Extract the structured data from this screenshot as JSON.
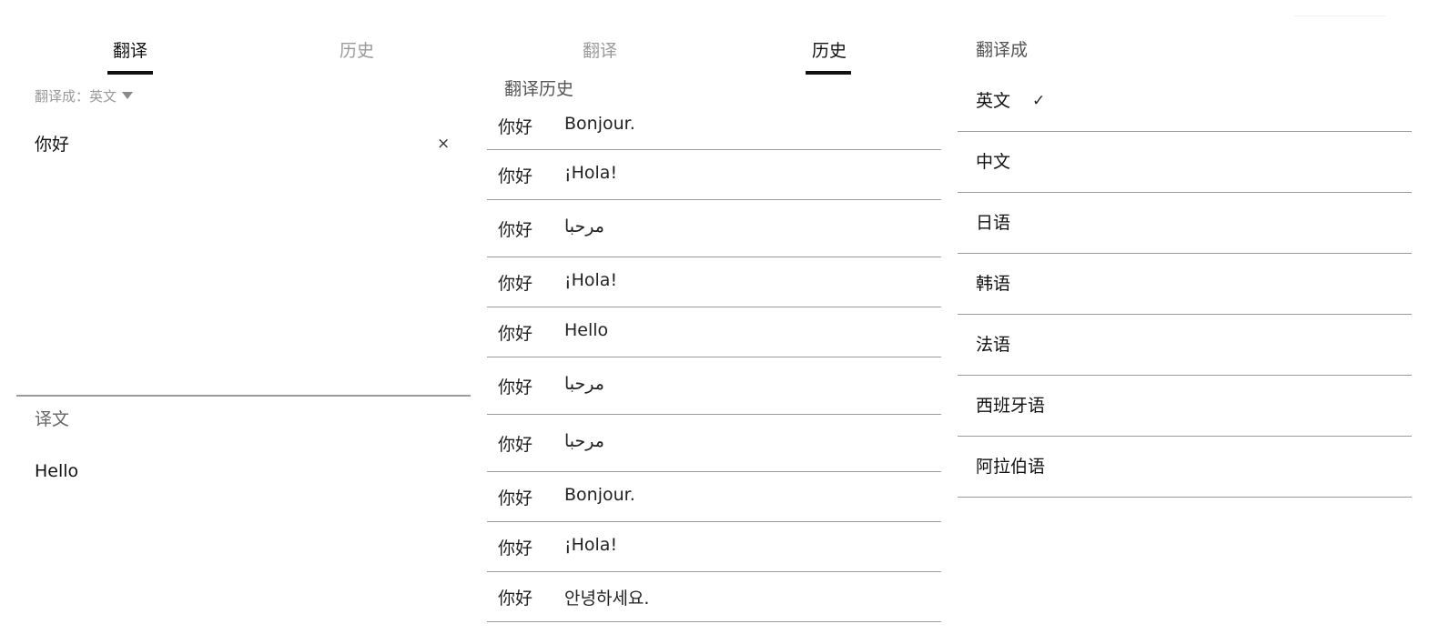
{
  "translate_panel": {
    "tab_translate": "翻译",
    "tab_history": "历史",
    "target_lang_picker": "翻译成：英文",
    "source_text": "你好",
    "clear_icon": "×",
    "result_label": "译文",
    "result_text": "Hello"
  },
  "history_panel": {
    "tab_translate": "翻译",
    "tab_history": "历史",
    "title": "翻译历史",
    "items": [
      {
        "source": "你好",
        "translation": "Bonjour."
      },
      {
        "source": "你好",
        "translation": "¡Hola!"
      },
      {
        "source": "你好",
        "translation": "مرحبا"
      },
      {
        "source": "你好",
        "translation": "¡Hola!"
      },
      {
        "source": "你好",
        "translation": "Hello"
      },
      {
        "source": "你好",
        "translation": "مرحبا"
      },
      {
        "source": "你好",
        "translation": "مرحبا"
      },
      {
        "source": "你好",
        "translation": "Bonjour."
      },
      {
        "source": "你好",
        "translation": "¡Hola!"
      },
      {
        "source": "你好",
        "translation": "안녕하세요."
      }
    ]
  },
  "language_panel": {
    "title": "翻译成",
    "selected_check": "✓",
    "languages": [
      {
        "name": "英文",
        "selected": true
      },
      {
        "name": "中文",
        "selected": false
      },
      {
        "name": "日语",
        "selected": false
      },
      {
        "name": "韩语",
        "selected": false
      },
      {
        "name": "法语",
        "selected": false
      },
      {
        "name": "西班牙语",
        "selected": false
      },
      {
        "name": "阿拉伯语",
        "selected": false
      }
    ]
  }
}
